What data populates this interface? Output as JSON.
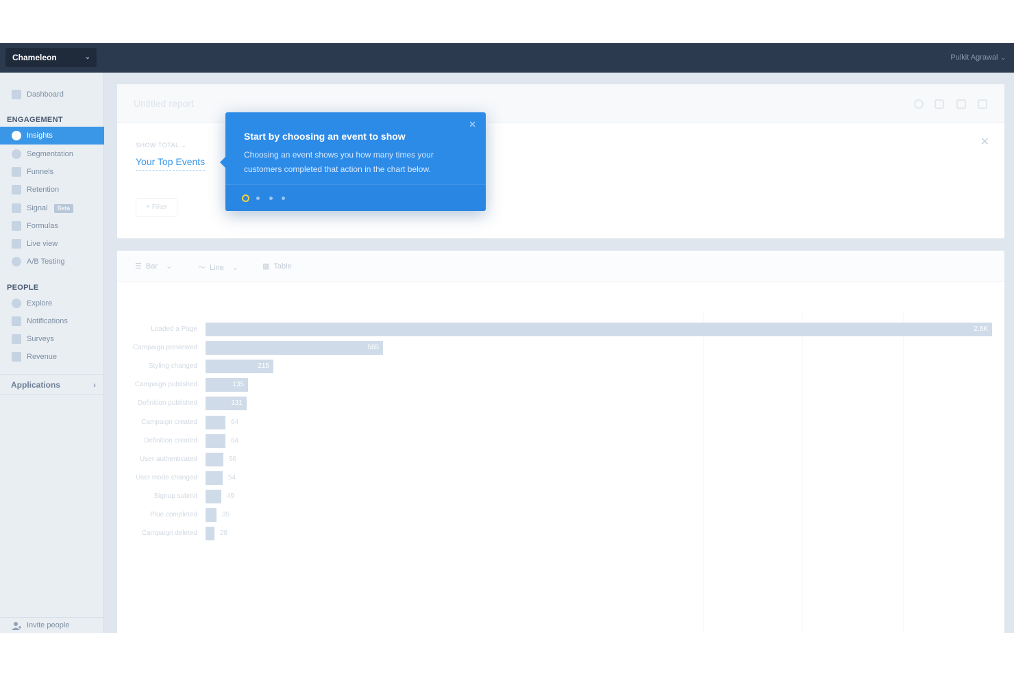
{
  "topbar": {
    "project": "Chameleon",
    "user": "Pulkit Agrawal"
  },
  "sidebar": {
    "dashboard": "Dashboard",
    "engagement_heading": "ENGAGEMENT",
    "engagement_items": [
      {
        "label": "Insights",
        "icon": "insights-icon",
        "active": true
      },
      {
        "label": "Segmentation",
        "icon": "segmentation-icon"
      },
      {
        "label": "Funnels",
        "icon": "funnel-icon"
      },
      {
        "label": "Retention",
        "icon": "retention-icon"
      },
      {
        "label": "Signal",
        "icon": "signal-icon",
        "badge": "Beta"
      },
      {
        "label": "Formulas",
        "icon": "formulas-icon"
      },
      {
        "label": "Live view",
        "icon": "live-view-icon"
      },
      {
        "label": "A/B Testing",
        "icon": "ab-testing-icon"
      }
    ],
    "people_heading": "PEOPLE",
    "people_items": [
      {
        "label": "Explore",
        "icon": "explore-icon"
      },
      {
        "label": "Notifications",
        "icon": "notifications-icon"
      },
      {
        "label": "Surveys",
        "icon": "surveys-icon"
      },
      {
        "label": "Revenue",
        "icon": "revenue-icon"
      }
    ],
    "applications": "Applications",
    "invite": "Invite people"
  },
  "report": {
    "title": "Untitled report",
    "show_total": "SHOW TOTAL",
    "top_events": "Your Top Events",
    "filter": "+ Filter"
  },
  "chart_toolbar": {
    "bar": "Bar",
    "line": "Line",
    "table": "Table"
  },
  "chart_data": {
    "type": "bar",
    "orientation": "horizontal",
    "categories": [
      "Loaded a Page",
      "Campaign previewed",
      "Styling changed",
      "Campaign published",
      "Definition published",
      "Campaign created",
      "Definition created",
      "User authenticated",
      "User mode changed",
      "Signup submit",
      "Plue completed",
      "Campaign deleted"
    ],
    "values": [
      2500,
      565,
      215,
      135,
      131,
      64,
      64,
      56,
      54,
      49,
      35,
      28
    ],
    "value_labels": [
      "2.5K",
      "565",
      "215",
      "135",
      "131",
      "64",
      "64",
      "56",
      "54",
      "49",
      "35",
      "28"
    ]
  },
  "tooltip": {
    "title": "Start by choosing an event to show",
    "body": "Choosing an event shows you how many times your customers completed that action in the chart below.",
    "steps": 4,
    "current_step": 1
  },
  "colors": {
    "topbar": "#2b3a4f",
    "accent": "#3a97e8",
    "tooltip": "#2d8be8",
    "bar": "#cfdbe8"
  }
}
